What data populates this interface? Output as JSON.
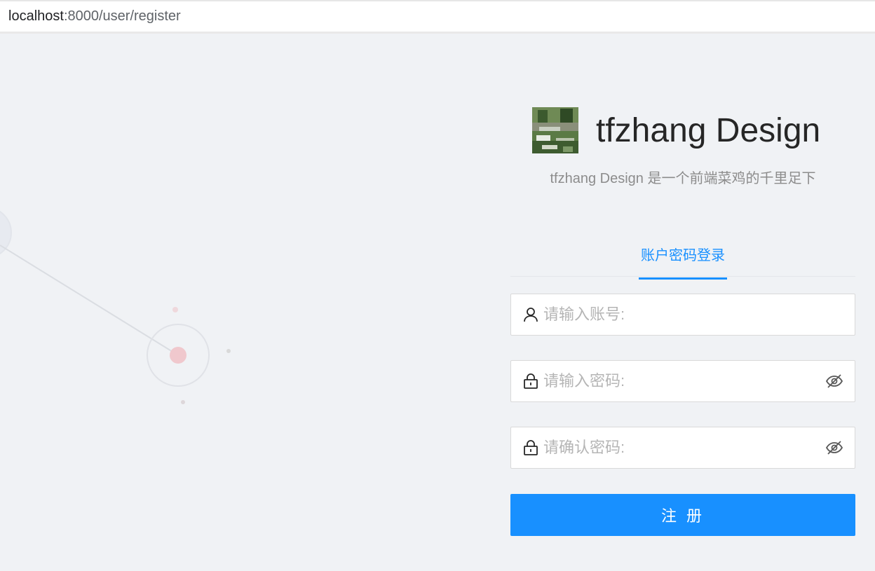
{
  "browser": {
    "url_host": "localhost",
    "url_path": ":8000/user/register"
  },
  "brand": {
    "title": "tfzhang Design",
    "subtitle": "tfzhang Design 是一个前端菜鸡的千里足下"
  },
  "tabs": [
    {
      "label": "账户密码登录",
      "active": true
    }
  ],
  "form": {
    "account": {
      "placeholder": "请输入账号:",
      "value": "",
      "icon": "user-icon"
    },
    "password": {
      "placeholder": "请输入密码:",
      "value": "",
      "icon": "lock-icon",
      "toggle_icon": "eye-invisible-icon"
    },
    "confirm_password": {
      "placeholder": "请确认密码:",
      "value": "",
      "icon": "lock-icon",
      "toggle_icon": "eye-invisible-icon"
    },
    "submit_label": "注 册"
  },
  "colors": {
    "primary": "#1890ff",
    "background": "#f0f2f5",
    "decoration_accent": "#f5c6cc"
  }
}
